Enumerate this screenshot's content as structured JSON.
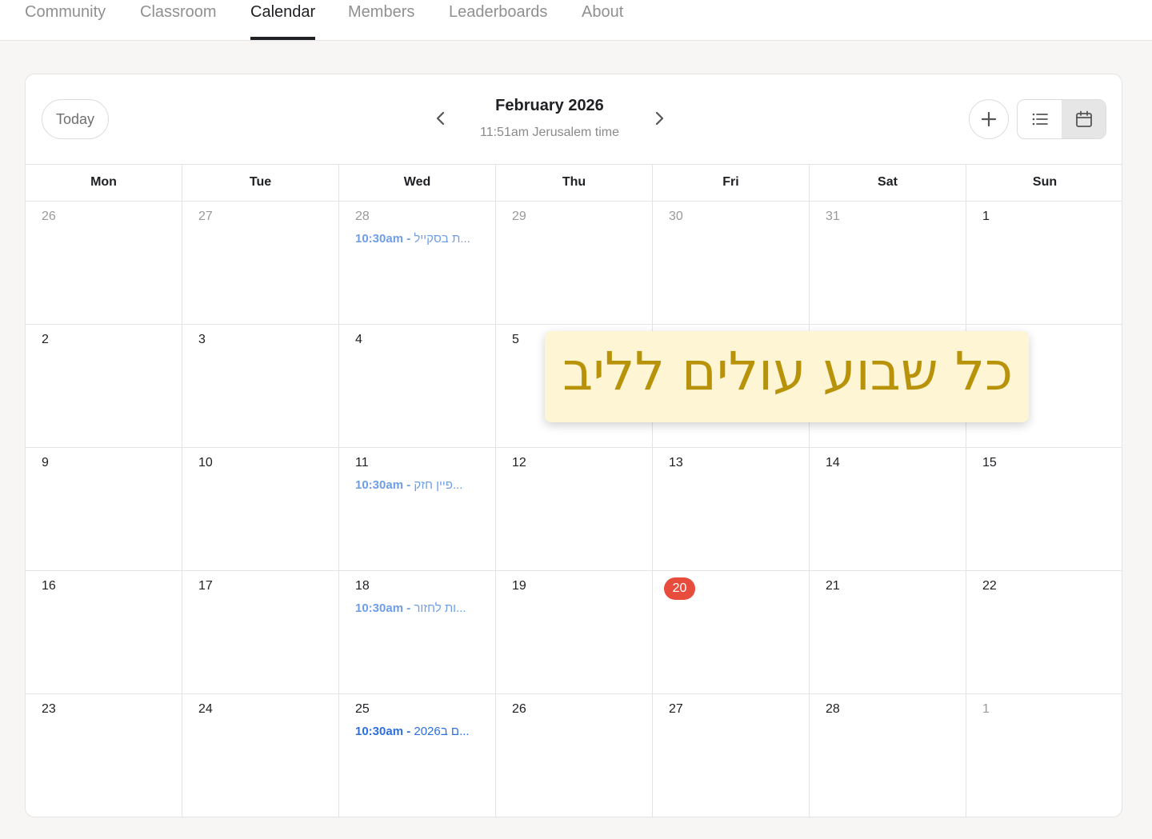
{
  "nav": {
    "tabs": [
      {
        "label": "Community",
        "active": false
      },
      {
        "label": "Classroom",
        "active": false
      },
      {
        "label": "Calendar",
        "active": true
      },
      {
        "label": "Members",
        "active": false
      },
      {
        "label": "Leaderboards",
        "active": false
      },
      {
        "label": "About",
        "active": false
      }
    ]
  },
  "toolbar": {
    "today_label": "Today",
    "month_title": "February 2026",
    "timezone_text": "11:51am Jerusalem time",
    "icons": {
      "prev": "chevron-left-icon",
      "next": "chevron-right-icon",
      "add": "plus-icon",
      "list": "list-view-icon",
      "calendar": "calendar-view-icon"
    },
    "active_view": "calendar"
  },
  "calendar": {
    "weekdays": [
      "Mon",
      "Tue",
      "Wed",
      "Thu",
      "Fri",
      "Sat",
      "Sun"
    ],
    "weeks": [
      [
        {
          "day": "26",
          "other": true
        },
        {
          "day": "27",
          "other": true
        },
        {
          "day": "28",
          "other": true,
          "event": {
            "time": "10:30am - ",
            "title": "ת בסקייל..."
          }
        },
        {
          "day": "29",
          "other": true
        },
        {
          "day": "30",
          "other": true
        },
        {
          "day": "31",
          "other": true
        },
        {
          "day": "1"
        }
      ],
      [
        {
          "day": "2"
        },
        {
          "day": "3"
        },
        {
          "day": "4"
        },
        {
          "day": "5"
        },
        {
          "day": ""
        },
        {
          "day": ""
        },
        {
          "day": ""
        }
      ],
      [
        {
          "day": "9"
        },
        {
          "day": "10"
        },
        {
          "day": "11",
          "event": {
            "time": "10:30am - ",
            "title": "פיין חזק..."
          }
        },
        {
          "day": "12"
        },
        {
          "day": "13"
        },
        {
          "day": "14"
        },
        {
          "day": "15"
        }
      ],
      [
        {
          "day": "16"
        },
        {
          "day": "17"
        },
        {
          "day": "18",
          "event": {
            "time": "10:30am - ",
            "title": "ות לחזור..."
          }
        },
        {
          "day": "19"
        },
        {
          "day": "20",
          "today": true
        },
        {
          "day": "21"
        },
        {
          "day": "22"
        }
      ],
      [
        {
          "day": "23"
        },
        {
          "day": "24"
        },
        {
          "day": "25",
          "event": {
            "time": "10:30am - ",
            "title": "2026ם ב...",
            "strong": true
          }
        },
        {
          "day": "26"
        },
        {
          "day": "27"
        },
        {
          "day": "28"
        },
        {
          "day": "1",
          "other": true
        }
      ]
    ],
    "colors": {
      "today": "#e74c3c",
      "event": "#6f9ee8",
      "event_strong": "#2d6fe0"
    }
  },
  "overlay": {
    "text": "כל שבוע עולים לליב",
    "color": "#b8930a",
    "background": "#fdf5d3"
  }
}
